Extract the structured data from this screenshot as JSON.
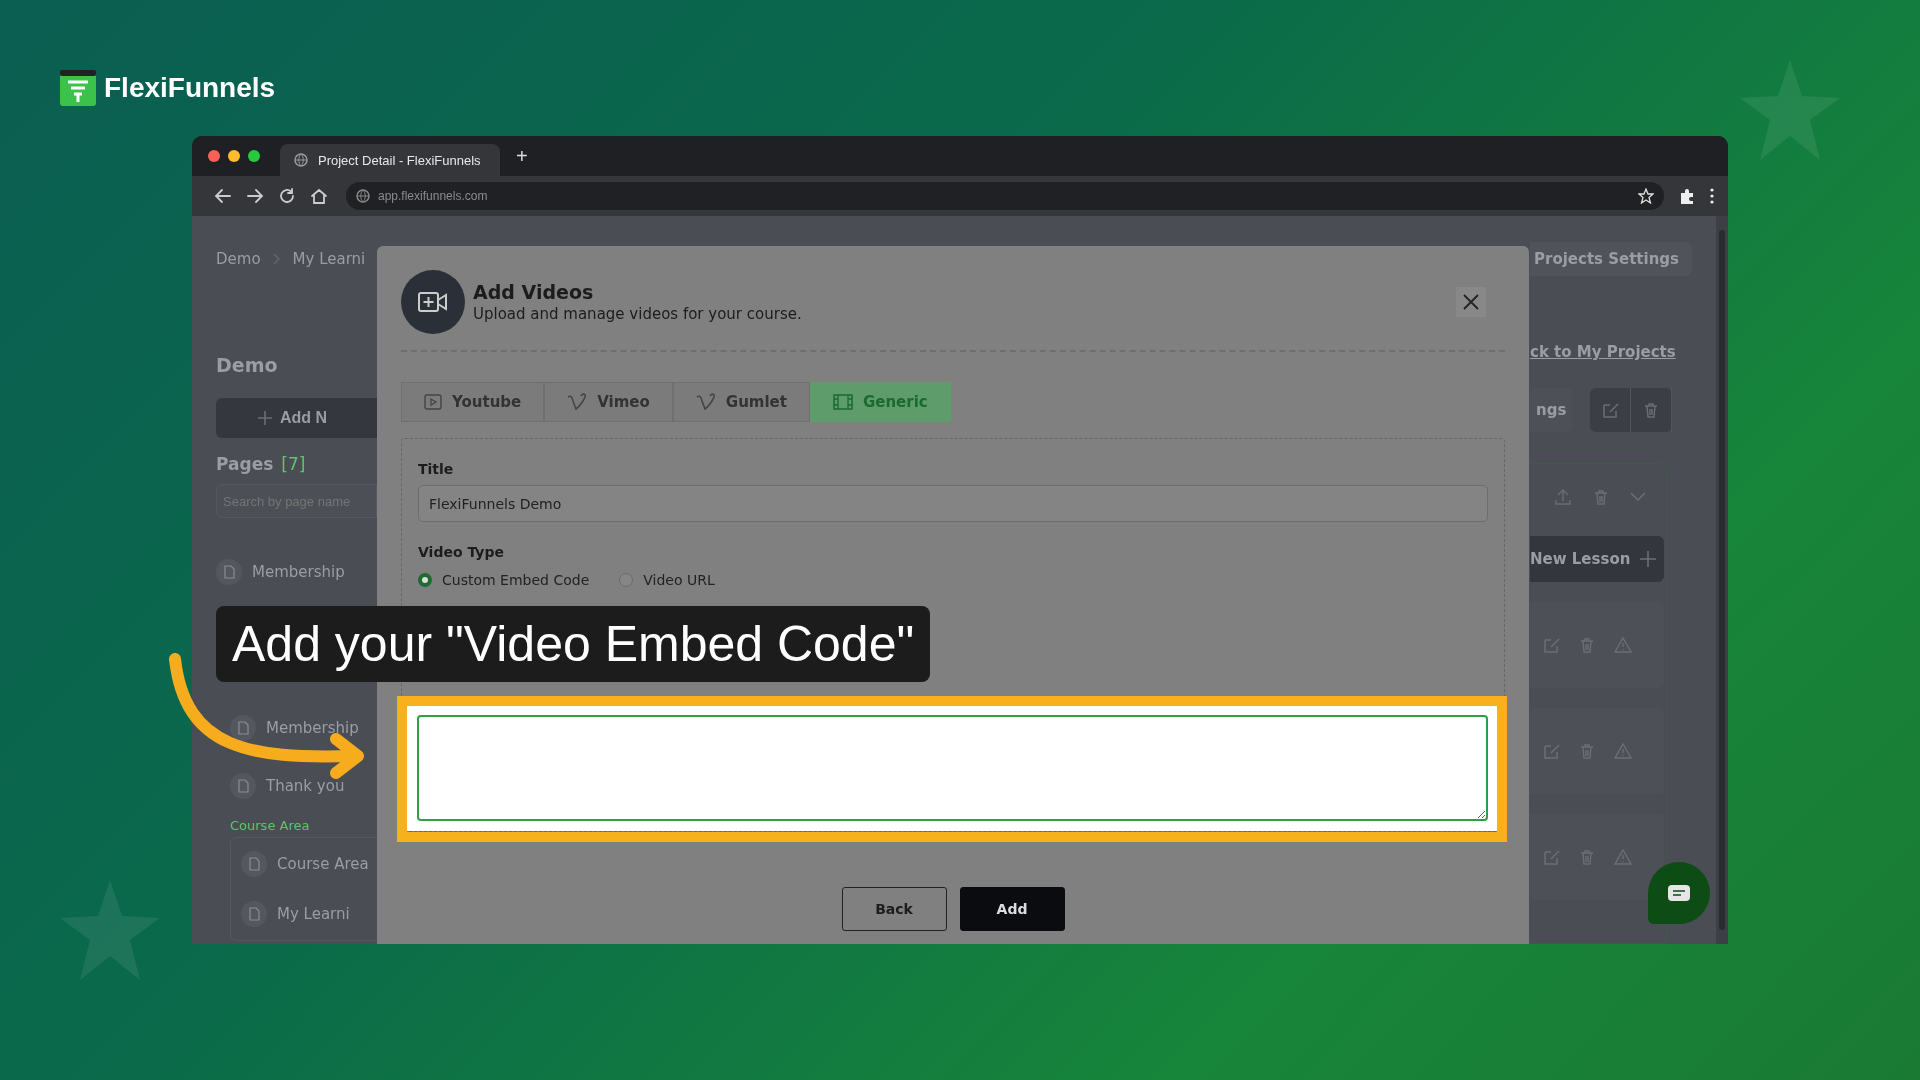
{
  "brand": {
    "name": "FlexiFunnels"
  },
  "browser": {
    "tab_title": "Project Detail - FlexiFunnels",
    "new_tab": "+",
    "url": "app.flexifunnels.com"
  },
  "left_panel": {
    "breadcrumb": [
      "Demo",
      "My Learni"
    ],
    "project_title": "Demo",
    "add_button": "Add N",
    "pages_label": "Pages",
    "pages_count": "[7]",
    "search_placeholder": "Search by page name",
    "pages_top": [
      {
        "name": "Membership"
      }
    ],
    "pages_bottom": [
      {
        "name": "Membership"
      },
      {
        "name": "Thank you"
      }
    ],
    "section_label": "Course Area",
    "course_items": [
      {
        "name": "Course Area"
      },
      {
        "name": "My Learni"
      }
    ]
  },
  "right_panel": {
    "settings_dropdown": "Projects Settings",
    "back_link": "ck to My Projects",
    "settings_button": "ngs",
    "new_lesson_button": "New Lesson"
  },
  "modal": {
    "title": "Add Videos",
    "subtitle": "Upload and manage videos for your course.",
    "tabs": [
      {
        "label": "Youtube",
        "selected": false
      },
      {
        "label": "Vimeo",
        "selected": false
      },
      {
        "label": "Gumlet",
        "selected": false
      },
      {
        "label": "Generic",
        "selected": true
      }
    ],
    "title_label": "Title",
    "title_value": "FlexiFunnels Demo",
    "video_type_label": "Video Type",
    "video_types": [
      {
        "label": "Custom Embed Code",
        "selected": true
      },
      {
        "label": "Video URL",
        "selected": false
      }
    ],
    "buttons": [
      {
        "label": "Back",
        "kind": "secondary"
      },
      {
        "label": "Add",
        "kind": "primary"
      }
    ]
  },
  "annotation": {
    "caption": "Add your \"Video Embed Code\""
  }
}
